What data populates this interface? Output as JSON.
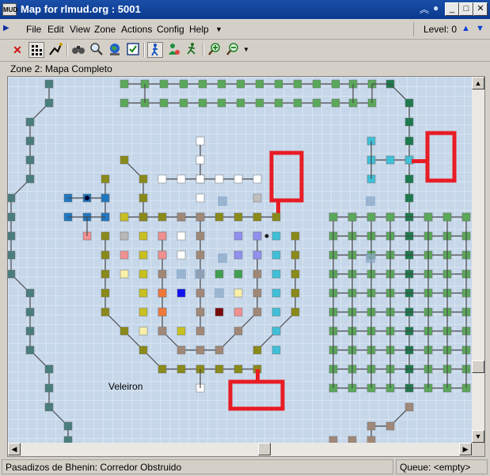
{
  "window": {
    "title": "Map for rlmud.org : 5001",
    "app_icon": "MUD"
  },
  "menu": [
    {
      "label": "File"
    },
    {
      "label": "Edit"
    },
    {
      "label": "View"
    },
    {
      "label": "Zone"
    },
    {
      "label": "Actions"
    },
    {
      "label": "Config"
    },
    {
      "label": "Help"
    }
  ],
  "level": {
    "label": "Level: 0"
  },
  "toolbar": [
    "close-icon",
    "grid-icon",
    "path-icon",
    "binoculars-icon",
    "magnifier-icon",
    "globe-icon",
    "checkbox-icon",
    "walk-icon",
    "user-icon",
    "run-icon",
    "zoom-in-icon",
    "zoom-out-icon"
  ],
  "zone": {
    "name": "Zone 2: Mapa Completo"
  },
  "map": {
    "area_label": "Veleiron"
  },
  "status": {
    "location": "Pasadizos de Bhenin: Corredor Obstruido",
    "queue": "Queue: <empty>"
  },
  "colors": {
    "green": "#5aa85a",
    "dark_green": "#1d7a4e",
    "olive": "#8a8a1a",
    "teal": "#4a7d7d",
    "cyan": "#40c0d8",
    "mauve": "#a08878",
    "highlight_red": "#e81c24"
  }
}
